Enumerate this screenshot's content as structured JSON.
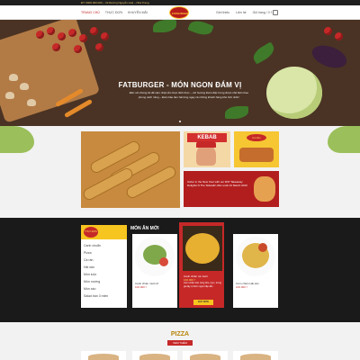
{
  "topbar": {
    "text": "ĐT: 0900.000.000 – 32 Đường Nguyễn Huệ – Nha Trang"
  },
  "header": {
    "nav": [
      "TRANG CHỦ",
      "THỰC ĐƠN",
      "KHUYẾN MÃI"
    ],
    "logo_text": "FATBURGER",
    "right_nav": [
      "Giới thiệu",
      "Liên hệ",
      "Giỏ hàng / 0 ₫"
    ]
  },
  "hero": {
    "title": "FATBURGER - MÓN NGON ĐÁM VỊ",
    "description": "Đến với chúng tôi để cảm nhận ẩm thực đích thực – với hương thơm đặc trưng được chế biến theo phong cách riêng – Đảm bảo làm hài lòng ngay cả những khách hàng khó tính nhất !"
  },
  "promos": {
    "kebab_title": "KEBAB",
    "combo_badge": "Combo",
    "red_banner_text": "Usher in the New Year with our D97 Takeaway Delights N The Sidewlk! offer ends 31 March 2016"
  },
  "sidebar": {
    "logo_text": "THỰC ĐƠN",
    "items": [
      "Canh chuẩn",
      "Pizza",
      "Cá rán",
      "Hải sản",
      "Món luộc",
      "Món nướng",
      "Món xào",
      "Salad bán 3 miền"
    ]
  },
  "new_dishes": {
    "section_title": "MÓN ĂN MỚI",
    "cards": [
      {
        "name": "Canh chiên muối ớt",
        "price": "100.000 ₫"
      },
      {
        "name": "Canh chiên cà muối",
        "price": "100.000 ₫",
        "desc": "Cơm chiên trộn cùng tôm, mực, trứng gà dậy vị thơm ngon hấp dẫn",
        "button": "ĐẶT MÓN"
      },
      {
        "name": "Cơm chiên Hải sản",
        "price": "100.000 ₫"
      },
      {
        "name": "Canh chiên bắp cải",
        "price": "80.000 ₫"
      }
    ]
  },
  "pizza": {
    "title": "PIZZA",
    "button": "XEM THÊM"
  },
  "colors": {
    "accent": "#c62828",
    "gold": "#f7c51f",
    "dark": "#1a1a1a"
  }
}
